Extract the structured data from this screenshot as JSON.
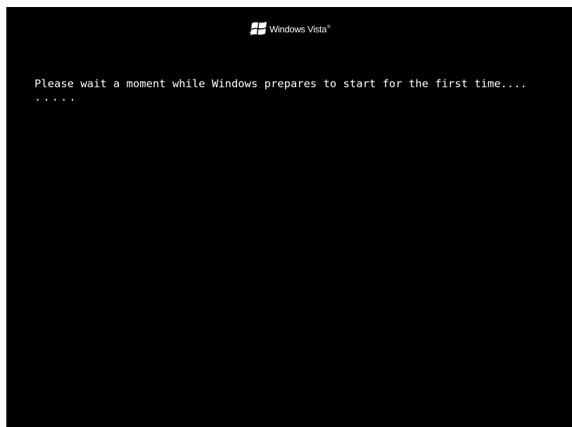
{
  "logo": {
    "icon": "windows-flag-icon",
    "brand_text": "Windows",
    "product_text": "Vista",
    "trademark": "®"
  },
  "console": {
    "message": "Please wait a moment while Windows prepares to start for the first time....",
    "progress_dots": "....."
  },
  "colors": {
    "background": "#000000",
    "text": "#ffffff",
    "frame": "#ffffff"
  }
}
